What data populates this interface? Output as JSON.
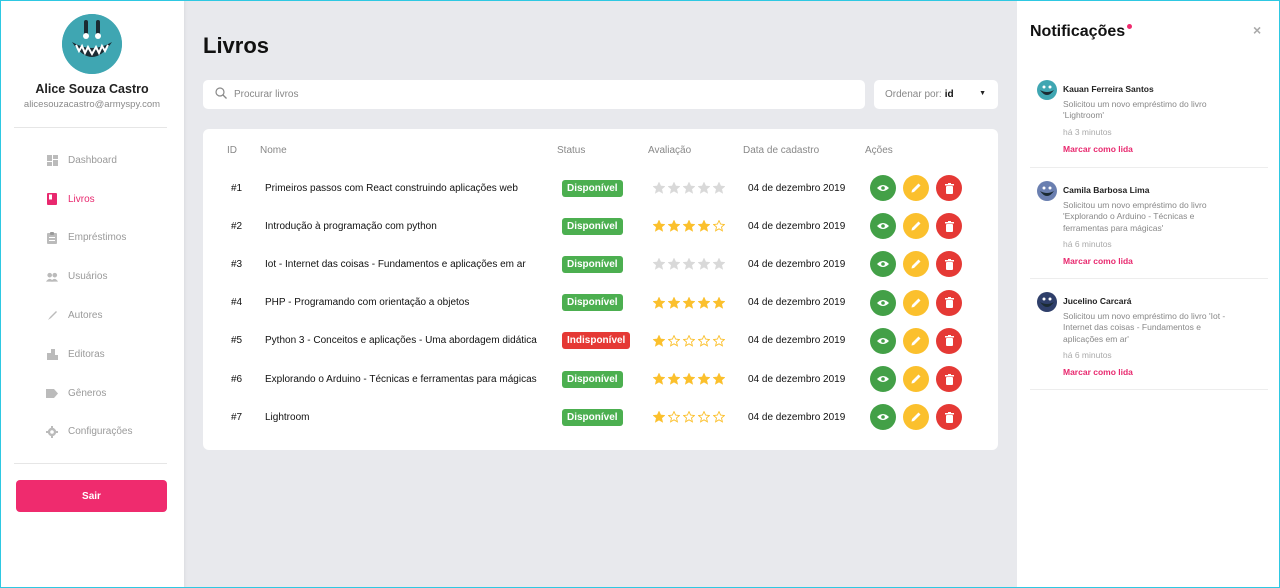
{
  "colors": {
    "accent": "#ef2b6e",
    "available": "#4caf50",
    "unavailable": "#e53935",
    "star": "#fbc02d",
    "action_view": "#43a047",
    "action_edit": "#fbc02d",
    "action_delete": "#e53935"
  },
  "user": {
    "name": "Alice Souza Castro",
    "email": "alicesouzacastro@armyspy.com"
  },
  "sidebar": {
    "items": [
      {
        "label": "Dashboard",
        "icon": "dashboard-icon",
        "active": false
      },
      {
        "label": "Livros",
        "icon": "book-icon",
        "active": true
      },
      {
        "label": "Empréstimos",
        "icon": "clipboard-icon",
        "active": false
      },
      {
        "label": "Usuários",
        "icon": "users-icon",
        "active": false
      },
      {
        "label": "Autores",
        "icon": "pen-icon",
        "active": false
      },
      {
        "label": "Editoras",
        "icon": "building-icon",
        "active": false
      },
      {
        "label": "Gêneros",
        "icon": "tag-icon",
        "active": false
      },
      {
        "label": "Configurações",
        "icon": "gear-icon",
        "active": false
      }
    ],
    "logout_label": "Sair"
  },
  "main": {
    "title": "Livros",
    "search_placeholder": "Procurar livros",
    "sort_label": "Ordenar por:",
    "sort_value": "id"
  },
  "table": {
    "headers": {
      "id": "ID",
      "name": "Nome",
      "status": "Status",
      "rating": "Avaliação",
      "date": "Data de cadastro",
      "actions": "Ações"
    },
    "rows": [
      {
        "id": "#1",
        "name": "Primeiros passos com React construindo aplicações web",
        "status": "Disponível",
        "available": true,
        "rating": 0,
        "date": "04 de dezembro 2019"
      },
      {
        "id": "#2",
        "name": "Introdução à programação com python",
        "status": "Disponível",
        "available": true,
        "rating": 4,
        "date": "04 de dezembro 2019"
      },
      {
        "id": "#3",
        "name": "Iot - Internet das coisas - Fundamentos e aplicações em ar",
        "status": "Disponível",
        "available": true,
        "rating": 0,
        "date": "04 de dezembro 2019"
      },
      {
        "id": "#4",
        "name": "PHP - Programando com orientação a objetos",
        "status": "Disponível",
        "available": true,
        "rating": 5,
        "date": "04 de dezembro 2019"
      },
      {
        "id": "#5",
        "name": "Python 3 - Conceitos e aplicações - Uma abordagem didática",
        "status": "Indisponível",
        "available": false,
        "rating": 1,
        "date": "04 de dezembro 2019"
      },
      {
        "id": "#6",
        "name": "Explorando o Arduino - Técnicas e ferramentas para mágicas",
        "status": "Disponível",
        "available": true,
        "rating": 5,
        "date": "04 de dezembro 2019"
      },
      {
        "id": "#7",
        "name": "Lightroom",
        "status": "Disponível",
        "available": true,
        "rating": 1,
        "date": "04 de dezembro 2019"
      }
    ]
  },
  "notifications": {
    "title": "Notificações",
    "close_icon": "×",
    "items": [
      {
        "name": "Kauan Ferreira Santos",
        "message_lines": [
          "Solicitou um novo empréstimo do livro",
          "'Lightroom'"
        ],
        "time": "há 3 minutos",
        "mark_label": "Marcar como lida",
        "avatar_color": "#3fa6b2"
      },
      {
        "name": "Camila Barbosa Lima",
        "message_lines": [
          "Solicitou um novo empréstimo do livro",
          "'Explorando o Arduino - Técnicas e",
          "ferramentas para mágicas'"
        ],
        "time": "há 6 minutos",
        "mark_label": "Marcar como lida",
        "avatar_color": "#6a7fb0"
      },
      {
        "name": "Jucelino Carcará",
        "message_lines": [
          "Solicitou um novo empréstimo do livro 'Iot -",
          "Internet das coisas - Fundamentos e",
          "aplicações em ar'"
        ],
        "time": "há 6 minutos",
        "mark_label": "Marcar como lida",
        "avatar_color": "#2f3f6a"
      }
    ]
  }
}
